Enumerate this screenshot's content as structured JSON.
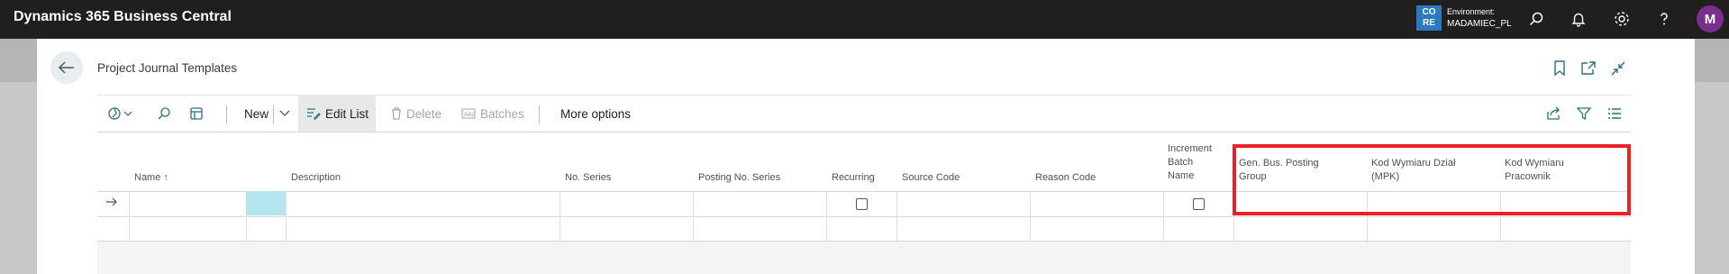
{
  "app": {
    "title": "Dynamics 365 Business Central",
    "environment_badge": [
      "CO",
      "RE"
    ],
    "environment_label": "Environment:",
    "environment_value": "MADAMIEC_PL",
    "avatar_initial": "M"
  },
  "page": {
    "title": "Project Journal Templates"
  },
  "action_bar": {
    "new_label": "New",
    "edit_list_label": "Edit List",
    "delete_label": "Delete",
    "batches_label": "Batches",
    "more_options_label": "More options"
  },
  "columns": {
    "name": "Name",
    "name_sort_indicator": "↑",
    "description": "Description",
    "no_series": "No. Series",
    "posting_no_series": "Posting No. Series",
    "recurring": "Recurring",
    "source_code": "Source Code",
    "reason_code": "Reason Code",
    "increment_batch_name": [
      "Increment",
      "Batch",
      "Name"
    ],
    "gen_bus_posting_group": [
      "Gen. Bus. Posting",
      "Group"
    ],
    "kod_wymiaru_dzial": [
      "Kod Wymiaru Dział",
      "(MPK)"
    ],
    "kod_wymiaru_pracownik": [
      "Kod Wymiaru",
      "Pracownik"
    ]
  },
  "rows": [
    {
      "current": true,
      "recurring": false,
      "increment_batch_name": false
    },
    {
      "current": false
    }
  ],
  "colors": {
    "topbar": "#201f1e",
    "accent_teal": "#b3e6ee",
    "highlight_red": "#e8212b",
    "avatar": "#7a2f8f",
    "env_badge": "#2a7ac1"
  }
}
